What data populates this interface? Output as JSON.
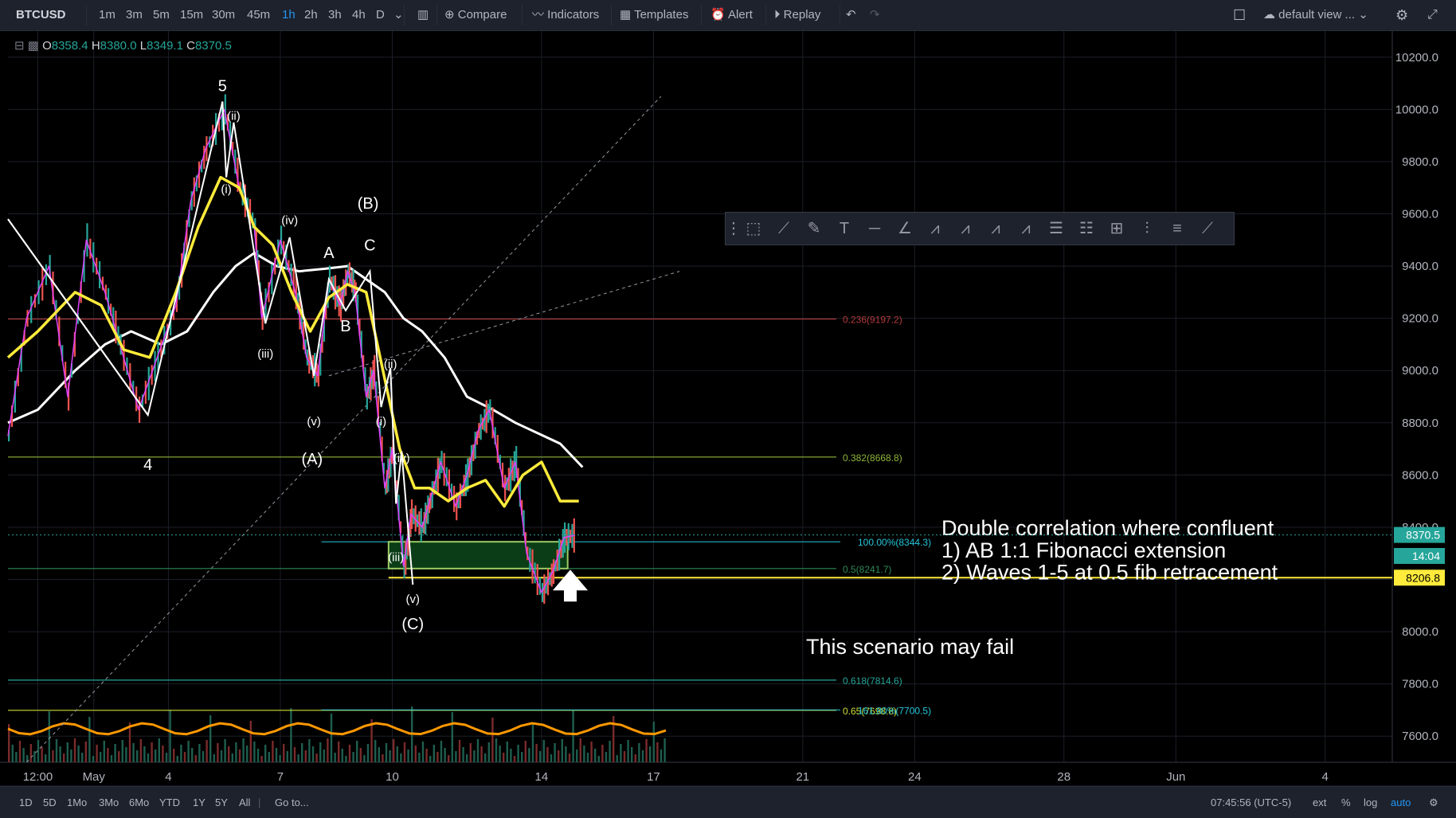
{
  "toolbar": {
    "symbol": "BTCUSD",
    "intervals": [
      "1m",
      "3m",
      "5m",
      "15m",
      "30m",
      "45m",
      "1h",
      "2h",
      "3h",
      "4h",
      "D"
    ],
    "active_interval": "1h",
    "compare": "Compare",
    "indicators": "Indicators",
    "templates": "Templates",
    "alert": "Alert",
    "replay": "Replay",
    "layout": "default view ..."
  },
  "legend": {
    "o": "8358.4",
    "h": "8380.0",
    "l": "8349.1",
    "c": "8370.5"
  },
  "bottom": {
    "ranges": [
      "1D",
      "5D",
      "1Mo",
      "3Mo",
      "6Mo",
      "YTD",
      "1Y",
      "5Y",
      "All"
    ],
    "goto": "Go to...",
    "time": "07:45:56 (UTC-5)",
    "ext": "ext",
    "pct": "%",
    "log": "log",
    "auto": "auto"
  },
  "chart_data": {
    "type": "line",
    "symbol": "BTCUSD",
    "ylim": [
      7500,
      10300
    ],
    "y_ticks": [
      7600,
      7800,
      8000,
      8200,
      8400,
      8600,
      8800,
      9000,
      9200,
      9400,
      9600,
      9800,
      10000,
      10200
    ],
    "x_tick_labels": [
      "12:00",
      "May",
      "4",
      "7",
      "10",
      "14",
      "17",
      "21",
      "24",
      "28",
      "Jun",
      "4"
    ],
    "x_tick_positions": [
      1.5,
      3,
      5,
      8,
      11,
      15,
      18,
      22,
      25,
      29,
      32,
      36
    ],
    "x_domain": [
      0.7,
      37.8
    ],
    "price_series": {
      "x": [
        0.7,
        1.2,
        1.8,
        2.3,
        2.8,
        3.3,
        3.7,
        4.2,
        4.7,
        5.2,
        5.6,
        6,
        6.5,
        6.9,
        7.3,
        7.5,
        8,
        8.4,
        8.7,
        9,
        9.3,
        9.6,
        9.8,
        10,
        10.3,
        10.5,
        10.8,
        11,
        11.3,
        11.5,
        11.8,
        12,
        12.3,
        12.7,
        13,
        13.3,
        13.6,
        14,
        14.3,
        14.6,
        15,
        15.3,
        15.6,
        15.9
      ],
      "values": [
        8750,
        9200,
        9400,
        8900,
        9500,
        9300,
        9100,
        8850,
        9050,
        9250,
        9650,
        9850,
        10000,
        9700,
        9550,
        9200,
        9500,
        9300,
        9050,
        8980,
        9350,
        9250,
        9380,
        9300,
        8900,
        9000,
        8550,
        8700,
        8250,
        8450,
        8400,
        8500,
        8650,
        8480,
        8600,
        8770,
        8850,
        8550,
        8650,
        8300,
        8150,
        8230,
        8360,
        8370
      ]
    },
    "ma_yellow": {
      "x": [
        0.7,
        1.5,
        2.5,
        3.2,
        3.8,
        4.5,
        5.2,
        5.8,
        6.4,
        6.9,
        7.3,
        7.8,
        8.3,
        8.8,
        9.3,
        9.8,
        10.3,
        10.6,
        10.9,
        11.2,
        11.6,
        12,
        12.5,
        13,
        13.5,
        14,
        14.5,
        15,
        15.5,
        16
      ],
      "values": [
        9050,
        9150,
        9300,
        9250,
        9080,
        9050,
        9300,
        9550,
        9740,
        9700,
        9550,
        9480,
        9300,
        9150,
        9280,
        9330,
        9300,
        9100,
        8900,
        8700,
        8550,
        8550,
        8500,
        8550,
        8580,
        8480,
        8600,
        8650,
        8500,
        8500
      ]
    },
    "ma_white": {
      "x": [
        0.7,
        1.5,
        2.5,
        3.3,
        4,
        4.8,
        5.5,
        6.2,
        6.8,
        7.3,
        7.9,
        8.5,
        9.2,
        9.8,
        10.3,
        10.8,
        11.3,
        11.8,
        12.4,
        13,
        13.7,
        14.3,
        14.9,
        15.5,
        16.1
      ],
      "values": [
        8800,
        8850,
        9000,
        9100,
        9150,
        9100,
        9150,
        9300,
        9400,
        9450,
        9400,
        9380,
        9390,
        9400,
        9350,
        9300,
        9200,
        9150,
        9050,
        8900,
        8850,
        8800,
        8760,
        8720,
        8630
      ]
    },
    "wave_labels": [
      {
        "text": "5",
        "x": 6.45,
        "y": 10070
      },
      {
        "text": "(ii)",
        "x": 6.75,
        "y": 9960
      },
      {
        "text": "(i)",
        "x": 6.55,
        "y": 9680
      },
      {
        "text": "4",
        "x": 4.45,
        "y": 8620
      },
      {
        "text": "(iv)",
        "x": 8.25,
        "y": 9560
      },
      {
        "text": "(iii)",
        "x": 7.6,
        "y": 9050
      },
      {
        "text": "(v)",
        "x": 8.9,
        "y": 8790
      },
      {
        "text": "(A)",
        "x": 8.85,
        "y": 8640
      },
      {
        "text": "(B)",
        "x": 10.35,
        "y": 9620
      },
      {
        "text": "A",
        "x": 9.3,
        "y": 9430
      },
      {
        "text": "C",
        "x": 10.4,
        "y": 9460
      },
      {
        "text": "B",
        "x": 9.75,
        "y": 9150
      },
      {
        "text": "(ii)",
        "x": 10.95,
        "y": 9010
      },
      {
        "text": "(i)",
        "x": 10.7,
        "y": 8790
      },
      {
        "text": "(iv)",
        "x": 11.25,
        "y": 8650
      },
      {
        "text": "(iii)",
        "x": 11.1,
        "y": 8270
      },
      {
        "text": "(v)",
        "x": 11.55,
        "y": 8110
      },
      {
        "text": "(C)",
        "x": 11.55,
        "y": 8010
      }
    ],
    "fib_levels": [
      {
        "label": "0.236(9197.2)",
        "y": 9197.2,
        "color": "#b33a3a"
      },
      {
        "label": "0.382(8668.8)",
        "y": 8668.8,
        "color": "#8fb63a"
      },
      {
        "label": "0.5(8241.7)",
        "y": 8241.7,
        "color": "#2e8b57"
      },
      {
        "label": "0.618(7814.6)",
        "y": 7814.6,
        "color": "#26a69a"
      },
      {
        "label": "0.65(7698.8)",
        "y": 7698.8,
        "color": "#cddc39"
      }
    ],
    "fib_extension_labels": [
      {
        "label": "100.00%(8344.3)",
        "y": 8344.3
      },
      {
        "label": "161.80%(7700.5)",
        "y": 7700.5
      }
    ],
    "last_price": "8370.5",
    "countdown": "14:04",
    "horizontal_line": "8206.8",
    "annotations": [
      "Double correlation where confluent",
      "1) AB 1:1 Fibonacci extension",
      "2) Waves 1-5 at 0.5 fib retracement",
      "This scenario may fail"
    ]
  }
}
